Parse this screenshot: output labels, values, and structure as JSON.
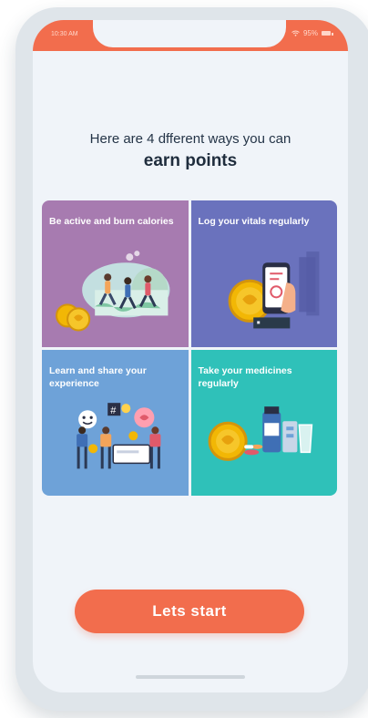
{
  "status_bar": {
    "time": "10:30 AM",
    "battery": "95%",
    "icons": [
      "wifi-icon",
      "battery-icon"
    ]
  },
  "intro": {
    "line1": "Here are 4 dfferent ways you can",
    "headline": "earn points"
  },
  "tiles": [
    {
      "label": "Be active and burn calories",
      "color": "#a77bb0",
      "icon": "runners-illustration"
    },
    {
      "label": "Log your vitals regularly",
      "color": "#6a72bd",
      "icon": "phone-vitals-illustration"
    },
    {
      "label": "Learn and share your experience",
      "color": "#6ea2d8",
      "icon": "sharing-people-illustration"
    },
    {
      "label": "Take your medicines regularly",
      "color": "#2fc1b9",
      "icon": "medicines-illustration"
    }
  ],
  "cta": {
    "label": "Lets start"
  },
  "colors": {
    "accent": "#f26d4d",
    "background": "#f0f4f9"
  }
}
